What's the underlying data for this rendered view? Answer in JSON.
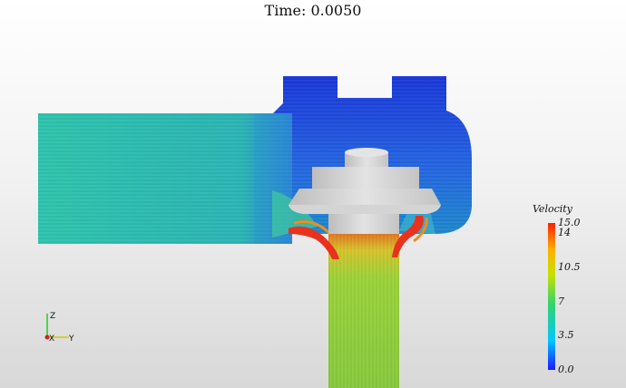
{
  "title": "Time: 0.0050",
  "legend": {
    "name": "Velocity",
    "labels": [
      "15.0",
      "14",
      "10.5",
      "7",
      "3.5",
      "0.0"
    ],
    "range": [
      0.0,
      15.0
    ],
    "colors": [
      "#1a1aff",
      "#00c8ff",
      "#35d46a",
      "#c8e000",
      "#ffb000",
      "#ff2000"
    ]
  },
  "axes": {
    "z": "Z",
    "x": "X",
    "y": "Y"
  },
  "colors": {
    "inlet_flow": "#2cc4aa",
    "chamber_flow": "#1f4fd6",
    "outlet_flow": "#8cce3a",
    "jet": "#e8321e",
    "valve": "#cfcfcf"
  }
}
